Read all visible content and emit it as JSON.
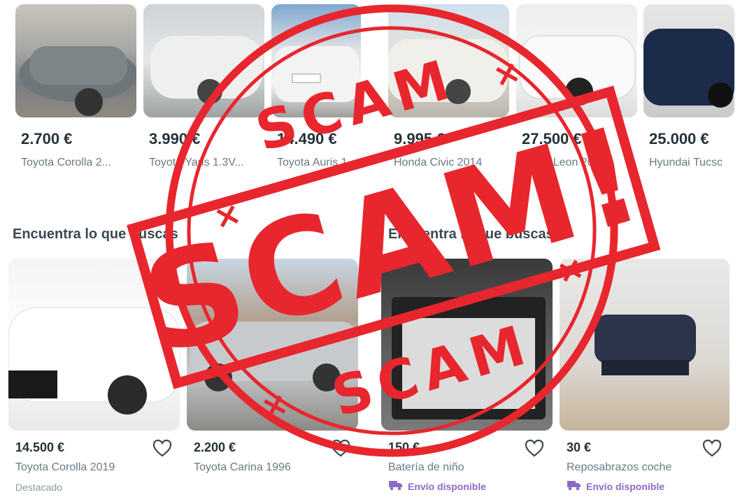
{
  "top_row": [
    {
      "price": "2.700 €",
      "title": "Toyota Corolla 2..."
    },
    {
      "price": "3.990 €",
      "title": "Toyota Yaris 1.3V..."
    },
    {
      "price": "14.490 €",
      "title": "Toyota Auris 1."
    },
    {
      "price": "9.995 €",
      "title": "Honda Civic 2014"
    },
    {
      "price": "27.500 €",
      "title": "SEAT Leon 202"
    },
    {
      "price": "25.000 €",
      "title": "Hyundai Tucsc"
    }
  ],
  "headings": {
    "left": "Encuentra lo que buscas",
    "right": "Encuentra lo que buscas"
  },
  "bottom_row": [
    {
      "price": "14.500 €",
      "title": "Toyota Corolla 2019",
      "tag": "Destacado"
    },
    {
      "price": "2.200 €",
      "title": "Toyota Carina 1996",
      "tag": ""
    },
    {
      "price": "150 €",
      "title": "Batería de niño",
      "tag": "Envío disponible"
    },
    {
      "price": "30 €",
      "title": "Reposabrazos coche",
      "tag": "Envío disponible"
    }
  ],
  "stamp": {
    "top": "SCAM",
    "main": "SCAM!",
    "bottom": "SCAM",
    "color": "#e8262d"
  },
  "icons": {
    "favorite": "heart-icon",
    "shipping": "truck-icon"
  }
}
